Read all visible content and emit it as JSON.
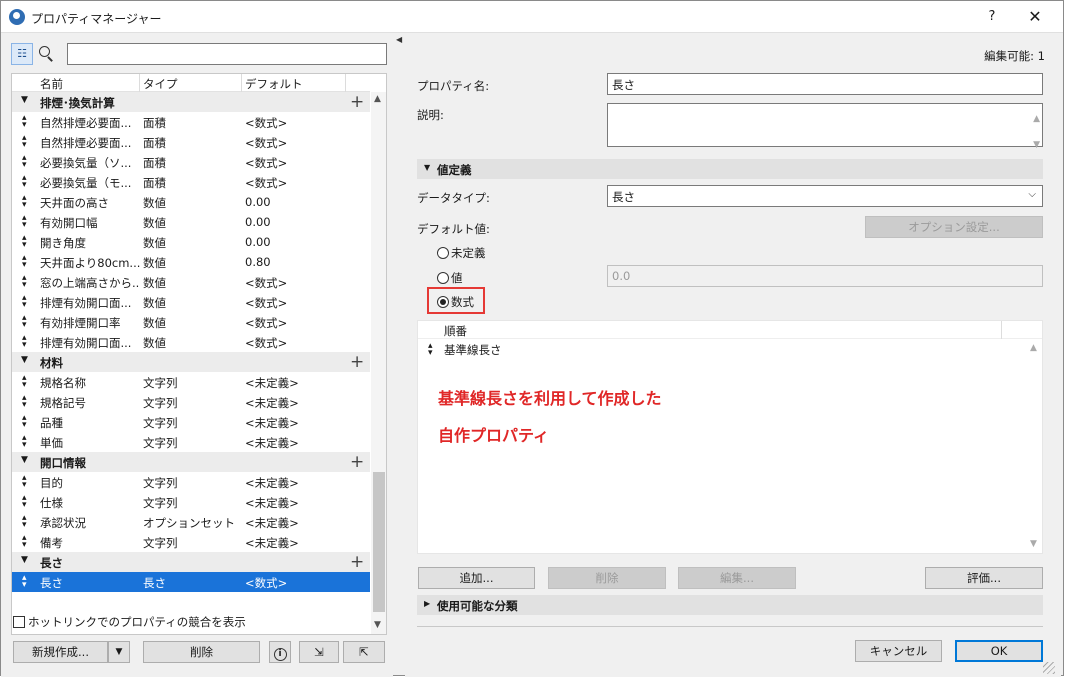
{
  "window": {
    "title": "プロパティマネージャー",
    "help_label": "?",
    "close_label": "✕"
  },
  "left": {
    "search_placeholder": "",
    "columns": [
      "名前",
      "タイプ",
      "デフォルト"
    ],
    "groups": [
      {
        "name": "排煙･換気計算",
        "rows": [
          {
            "name": "自然排煙必要面...",
            "type": "面積",
            "default": "<数式>"
          },
          {
            "name": "自然排煙必要面...",
            "type": "面積",
            "default": "<数式>"
          },
          {
            "name": "必要換気量（ソ...",
            "type": "面積",
            "default": "<数式>"
          },
          {
            "name": "必要換気量（モ...",
            "type": "面積",
            "default": "<数式>"
          },
          {
            "name": "天井面の高さ",
            "type": "数値",
            "default": "0.00"
          },
          {
            "name": "有効開口幅",
            "type": "数値",
            "default": "0.00"
          },
          {
            "name": "開き角度",
            "type": "数値",
            "default": "0.00"
          },
          {
            "name": "天井面より80cm...",
            "type": "数値",
            "default": "0.80"
          },
          {
            "name": "窓の上端高さから...",
            "type": "数値",
            "default": "<数式>"
          },
          {
            "name": "排煙有効開口面...",
            "type": "数値",
            "default": "<数式>"
          },
          {
            "name": "有効排煙開口率",
            "type": "数値",
            "default": "<数式>"
          },
          {
            "name": "排煙有効開口面...",
            "type": "数値",
            "default": "<数式>"
          }
        ]
      },
      {
        "name": "材料",
        "rows": [
          {
            "name": "規格名称",
            "type": "文字列",
            "default": "<未定義>"
          },
          {
            "name": "規格記号",
            "type": "文字列",
            "default": "<未定義>"
          },
          {
            "name": "品種",
            "type": "文字列",
            "default": "<未定義>"
          },
          {
            "name": "単価",
            "type": "文字列",
            "default": "<未定義>"
          }
        ]
      },
      {
        "name": "開口情報",
        "rows": [
          {
            "name": "目的",
            "type": "文字列",
            "default": "<未定義>"
          },
          {
            "name": "仕様",
            "type": "文字列",
            "default": "<未定義>"
          },
          {
            "name": "承認状況",
            "type": "オプションセット",
            "default": "<未定義>"
          },
          {
            "name": "備考",
            "type": "文字列",
            "default": "<未定義>"
          }
        ]
      },
      {
        "name": "長さ",
        "rows": [
          {
            "name": "長さ",
            "type": "長さ",
            "default": "<数式>",
            "selected": true
          }
        ]
      }
    ],
    "hotlink_checkbox_label": "ホットリンクでのプロパティの競合を表示",
    "new_button": "新規作成...",
    "delete_button": "削除"
  },
  "right": {
    "editable_label": "編集可能: 1",
    "property_name_label": "プロパティ名:",
    "property_name_value": "長さ",
    "description_label": "説明:",
    "description_value": "",
    "value_definition_section": "値定義",
    "data_type_label": "データタイプ:",
    "data_type_value": "長さ",
    "default_value_label": "デフォルト値:",
    "option_settings_button": "オプション設定...",
    "radio_undefined": "未定義",
    "radio_value": "値",
    "value_field": "0.0",
    "radio_formula": "数式",
    "formula_header": "順番",
    "formula_row": "基準線長さ",
    "annotation_line1": "基準線長さを利用して作成した",
    "annotation_line2": "自作プロパティ",
    "add_button": "追加...",
    "delete_button": "削除",
    "edit_button": "編集...",
    "evaluate_button": "評価...",
    "available_categories_section": "使用可能な分類",
    "cancel_button": "キャンセル",
    "ok_button": "OK"
  },
  "colors": {
    "selection": "#1a73d9",
    "annotation": "#e02727",
    "highlight_box": "#e53935"
  }
}
